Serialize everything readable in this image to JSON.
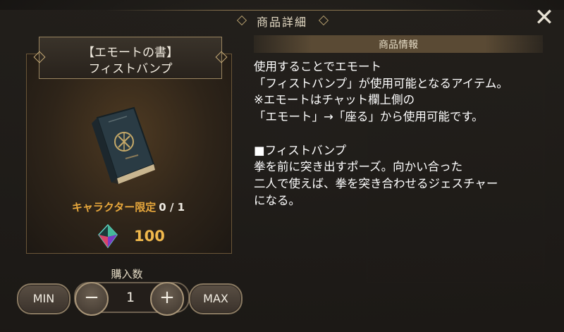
{
  "modal": {
    "title": "商品詳細",
    "close_icon": "close-icon"
  },
  "item": {
    "name_line1": "【エモートの書】",
    "name_line2": "フィストバンプ",
    "image": "emote-book-icon",
    "limit_label": "キャラクター限定",
    "limit_value": "0 / 1",
    "currency_icon": "crystal-gem-icon",
    "price": "100"
  },
  "info": {
    "header": "商品情報",
    "lines": [
      "使用することでエモート",
      "「フィストバンプ」が使用可能となるアイテム。",
      "※エモートはチャット欄上側の",
      "「エモート」→「座る」から使用可能です。",
      "",
      "■フィストバンプ",
      "拳を前に突き出すポーズ。向かい合った",
      "二人で使えば、拳を突き合わせるジェスチャー",
      "になる。"
    ]
  },
  "purchase": {
    "qty_label": "購入数",
    "min_label": "MIN",
    "minus_label": "−",
    "quantity": "1",
    "plus_label": "+",
    "max_label": "MAX"
  },
  "colors": {
    "accent": "#e8a83c",
    "price": "#f0b84c",
    "panel_border": "#6b5638"
  }
}
